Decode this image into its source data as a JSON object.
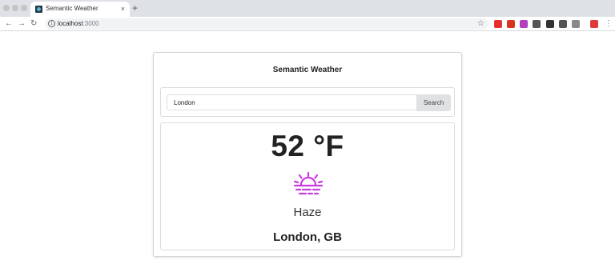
{
  "browser": {
    "tab": {
      "title": "Semantic Weather",
      "close_glyph": "×"
    },
    "new_tab_glyph": "+",
    "nav": {
      "back": "←",
      "forward": "→",
      "reload": "↻"
    },
    "address": {
      "host": "localhost",
      "port": ":3000"
    },
    "star_glyph": "☆",
    "menu_glyph": "⋮",
    "extension_colors": [
      "#e8312f",
      "#d6351f",
      "#b23fbf",
      "#555555",
      "#333333",
      "#555555",
      "#888888",
      "#e03a3a"
    ]
  },
  "app": {
    "title": "Semantic Weather",
    "search": {
      "value": "London",
      "placeholder": "",
      "button_label": "Search"
    },
    "weather": {
      "temperature": "52 °F",
      "icon": "haze-icon",
      "icon_color": "#c93ce0",
      "condition": "Haze",
      "location": "London, GB"
    }
  }
}
